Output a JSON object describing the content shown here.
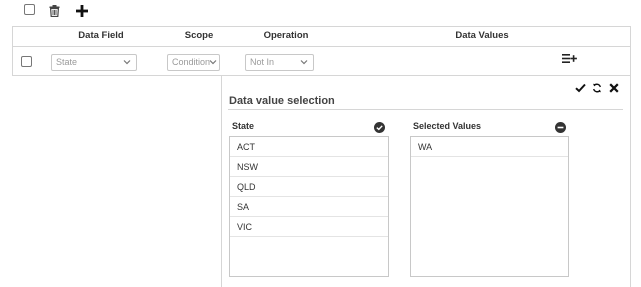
{
  "toolbar": {
    "icons": [
      "checkbox",
      "trash-icon",
      "plus-icon"
    ]
  },
  "table": {
    "headers": {
      "data_field": "Data Field",
      "scope": "Scope",
      "operation": "Operation",
      "data_values": "Data Values"
    },
    "row": {
      "data_field_value": "State",
      "scope_value": "Condition",
      "operation_value": "Not In",
      "data_values_icon": "list-add-icon"
    }
  },
  "panel": {
    "title": "Data value selection",
    "action_icons": [
      "check-icon",
      "reset-icon",
      "close-icon"
    ],
    "source": {
      "title": "State",
      "icon": "check-circle-icon",
      "items": [
        "ACT",
        "NSW",
        "QLD",
        "SA",
        "VIC"
      ]
    },
    "selected": {
      "title": "Selected Values",
      "icon": "minus-circle-icon",
      "items": [
        "WA"
      ]
    }
  },
  "colors": {
    "border": "#d6d6d6",
    "text": "#333333",
    "placeholder": "#9a9a9a"
  }
}
